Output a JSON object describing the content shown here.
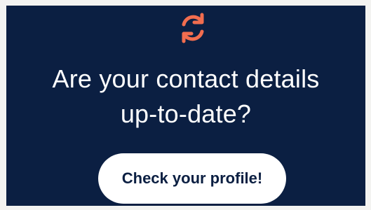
{
  "banner": {
    "icon": "sync-icon",
    "icon_color": "#f26d4f",
    "background_color": "#0b1f42",
    "headline_line1": "Are your contact details",
    "headline_line2": "up-to-date?",
    "button_label": "Check your profile!"
  }
}
